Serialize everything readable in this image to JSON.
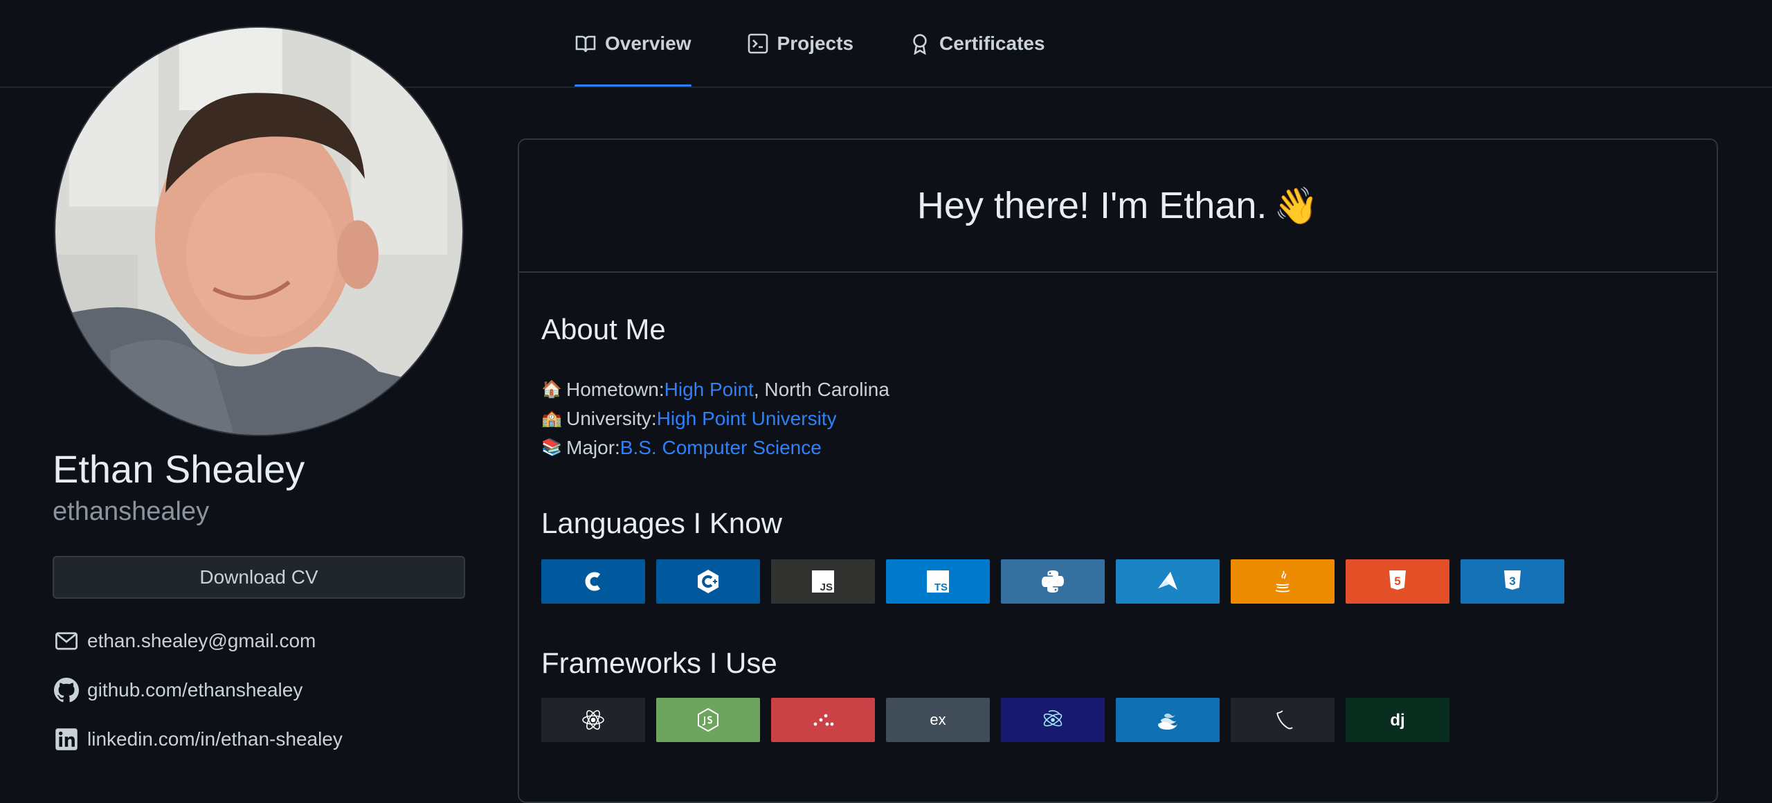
{
  "nav": {
    "tabs": [
      {
        "label": "Overview",
        "icon": "book-icon",
        "active": true
      },
      {
        "label": "Projects",
        "icon": "terminal-icon",
        "active": false
      },
      {
        "label": "Certificates",
        "icon": "award-icon",
        "active": false
      }
    ]
  },
  "profile": {
    "name": "Ethan Shealey",
    "username": "ethanshealey",
    "download_label": "Download CV",
    "contacts": {
      "email": "ethan.shealey@gmail.com",
      "github": "github.com/ethanshealey",
      "linkedin": "linkedin.com/in/ethan-shealey"
    }
  },
  "card": {
    "greeting": "Hey there! I'm Ethan.",
    "greeting_emoji": "👋",
    "about_title": "About Me",
    "about": {
      "hometown": {
        "emoji": "🏠",
        "label": "Hometown: ",
        "link": "High Point",
        "suffix": ", North Carolina"
      },
      "university": {
        "emoji": "🏫",
        "label": "University: ",
        "link": "High Point University"
      },
      "major": {
        "emoji": "📚",
        "label": "Major: ",
        "link": "B.S. Computer Science"
      }
    },
    "languages_title": "Languages I Know",
    "frameworks_title": "Frameworks I Use",
    "languages": [
      {
        "name": "c",
        "icon": "c-logo-icon",
        "color": "#00599C"
      },
      {
        "name": "cpp",
        "icon": "cpp-logo-icon",
        "color": "#00599C"
      },
      {
        "name": "javascript",
        "icon": "js-logo-icon",
        "color": "#323330",
        "text": "JS"
      },
      {
        "name": "typescript",
        "icon": "ts-logo-icon",
        "color": "#007ACC",
        "text": "TS"
      },
      {
        "name": "python",
        "icon": "python-logo-icon",
        "color": "#3670A0"
      },
      {
        "name": "kotlin-like",
        "icon": "arrow-logo-icon",
        "color": "#1A84C4"
      },
      {
        "name": "java",
        "icon": "java-logo-icon",
        "color": "#ED8B00"
      },
      {
        "name": "html5",
        "icon": "html5-logo-icon",
        "color": "#E34F26",
        "text": "5"
      },
      {
        "name": "css3",
        "icon": "css3-logo-icon",
        "color": "#1572B6",
        "text": "3"
      }
    ],
    "frameworks": [
      {
        "name": "react",
        "icon": "react-logo-icon",
        "color": "#20232A"
      },
      {
        "name": "nodejs",
        "icon": "nodejs-logo-icon",
        "color": "#6DA55F"
      },
      {
        "name": "nestlike",
        "icon": "dots-logo-icon",
        "color": "#CA4245"
      },
      {
        "name": "express",
        "icon": "express-logo-icon",
        "color": "#404D59",
        "text": "ex"
      },
      {
        "name": "electron",
        "icon": "electron-logo-icon",
        "color": "#191970"
      },
      {
        "name": "mui",
        "icon": "moon-logo-icon",
        "color": "#0F6FB3"
      },
      {
        "name": "flask",
        "icon": "flask-logo-icon",
        "color": "#20232A"
      },
      {
        "name": "django",
        "icon": "django-logo-icon",
        "color": "#092E20",
        "text": "dj"
      }
    ]
  },
  "colors": {
    "accent": "#2f81f7",
    "background": "#0d1117",
    "border": "#30363d"
  }
}
